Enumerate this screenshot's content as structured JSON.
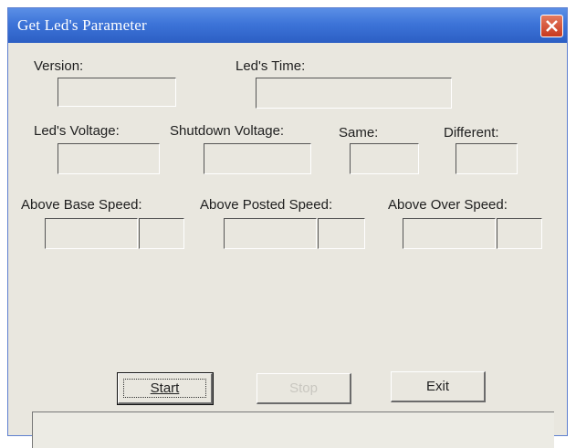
{
  "window": {
    "title": "Get Led's Parameter"
  },
  "fields": {
    "version_label": "Version:",
    "led_time_label": "Led's Time:",
    "led_voltage_label": "Led's Voltage:",
    "shutdown_voltage_label": "Shutdown Voltage:",
    "same_label": "Same:",
    "different_label": "Different:",
    "above_base_speed_label": "Above Base Speed:",
    "above_posted_speed_label": "Above Posted Speed:",
    "above_over_speed_label": "Above Over Speed:"
  },
  "buttons": {
    "start_label": "Start",
    "stop_label": "Stop",
    "exit_label": "Exit"
  },
  "icons": {
    "close": "close-icon"
  }
}
